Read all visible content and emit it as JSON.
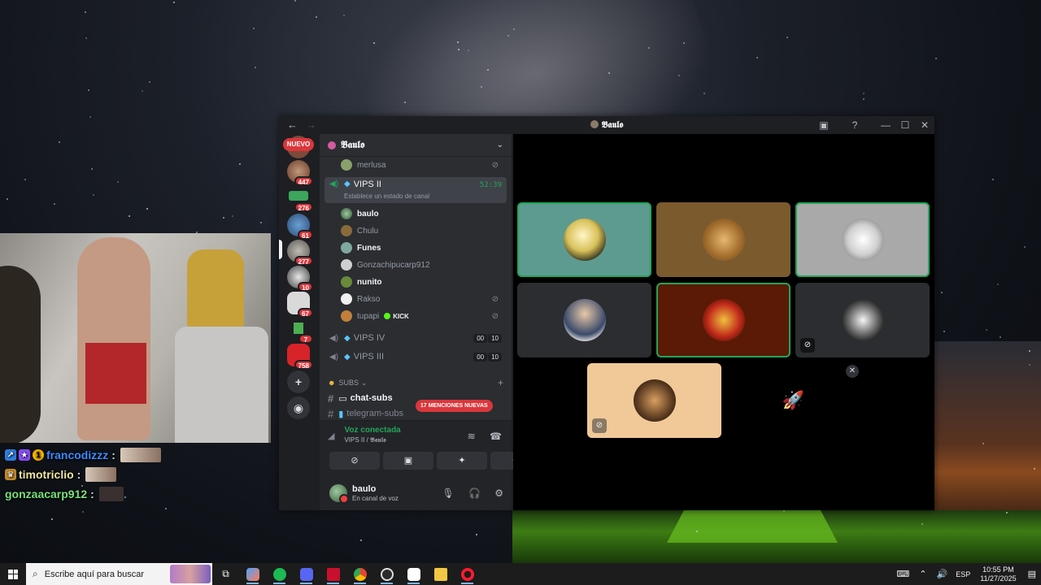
{
  "chat_overlay": [
    {
      "user": "francodizzz",
      "sep": ":",
      "color": "#3b8cff",
      "badges": [
        "#2f7de0",
        "#8a4cff",
        "#f5b400"
      ]
    },
    {
      "user": "timotriclio",
      "sep": ":",
      "color": "#f0e6a0",
      "badges": [
        "#c58a2a"
      ]
    },
    {
      "user": "gonzaacarp912",
      "sep": ":",
      "color": "#7be07b",
      "badges": []
    }
  ],
  "discord": {
    "window_title": "𝕭𝖆𝖚𝖑𝖔",
    "server_name": "𝕭𝖆𝖚𝖑𝖔",
    "rail": {
      "nuevo_label": "NUEVO",
      "badges": [
        "447",
        "276",
        "61",
        "277",
        "10",
        "67",
        "7",
        "758"
      ]
    },
    "channels": {
      "prev_user": "merlusa",
      "selected": {
        "name": "VIPS II",
        "time": "52:39",
        "status": "Establece un estado de canal"
      },
      "users": [
        {
          "name": "baulo",
          "active": true,
          "muted": false
        },
        {
          "name": "Chulu",
          "active": false,
          "muted": false
        },
        {
          "name": "Funes",
          "active": true,
          "muted": false
        },
        {
          "name": "Gonzachipucarp912",
          "active": false,
          "muted": false
        },
        {
          "name": "nunito",
          "active": true,
          "muted": false
        },
        {
          "name": "Rakso",
          "active": false,
          "muted": true
        },
        {
          "name": "tupapi",
          "active": false,
          "muted": true,
          "tag": "KICK"
        }
      ],
      "other_voice": [
        {
          "name": "VIPS IV",
          "a": "00",
          "b": "10"
        },
        {
          "name": "VIPS III",
          "a": "00",
          "b": "10"
        }
      ],
      "category": "SUBS",
      "text_channels": [
        {
          "name": "chat-subs"
        },
        {
          "name": "telegram-subs"
        }
      ],
      "mentions_label": "17 MENCIONES NUEVAS"
    },
    "voice_panel": {
      "status": "Voz conectada",
      "channel": "VIPS II / 𝕭𝖆𝖚𝖑𝖔"
    },
    "user_panel": {
      "name": "baulo",
      "sub": "En canal de voz"
    }
  },
  "taskbar": {
    "search_placeholder": "Escribe aquí para buscar",
    "lang": "ESP",
    "time": "10:55 PM",
    "date": "11/27/2025"
  },
  "colors": {
    "discord_bg": "#1e1f22",
    "sidebar_bg": "#2b2d31",
    "speaking_green": "#23a559",
    "mention_red": "#da373c"
  }
}
